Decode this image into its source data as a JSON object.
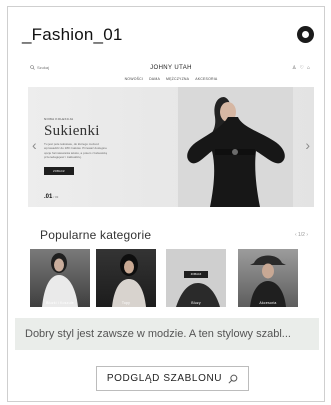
{
  "card": {
    "title": "_Fashion_01",
    "description": "Dobry styl jest zawsze w modzie. A ten stylowy szabl...",
    "preview_button_label": "PODGLĄD SZABLONU"
  },
  "preview": {
    "search_label": "Szukaj",
    "brand": "JOHNY UTAH",
    "nav": [
      "NOWOŚCI",
      "DAMA",
      "MĘŻCZYZNA",
      "AKCESORIA"
    ],
    "hero": {
      "kicker": "NOWA KOLEKCJA",
      "title": "Sukienki",
      "description": "Tu jest pole tekstowe, do którego możesz wprowadzić do 180 znaków. Przeważ dostępne opcje formatowania tekstu, a potem z łatwością przeredagujesz i zaktualizuj.",
      "cta": "ZOBACZ",
      "counter": ".01",
      "counter_total": "/ 03"
    },
    "categories": {
      "title": "Popularne kategorie",
      "nav": "‹ 1/2 ›",
      "items": [
        {
          "label": "Bluzki i Koszule"
        },
        {
          "label": "Topy"
        },
        {
          "label": "Bluzy",
          "button": "ZOBACZ"
        },
        {
          "label": "Akcesoria"
        }
      ]
    }
  },
  "colors": {
    "accent": "#1b1b1b",
    "description_bg": "#eaedea"
  },
  "icons": {
    "badge": "circle-badge-icon",
    "search": "search-icon"
  }
}
